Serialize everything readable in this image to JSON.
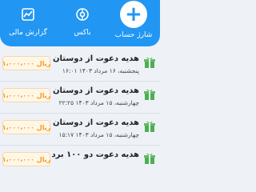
{
  "actions": {
    "report_label": "گزارش مالی",
    "box_label": "باکس",
    "charge_label": "شارژ حساب"
  },
  "colors": {
    "primary": "#2196f3",
    "amount_text": "#f29b1d",
    "gift_icon": "#4caf50"
  },
  "transactions": [
    {
      "title": "هدیه دعوت از دوستان",
      "date": "پنجشنبه، ۱۶ مرداد ۱۴۰۳ ۱۶:۰۱",
      "amount": "۱،۰۰۰،۰۰۰ ریال",
      "icon": "gift-icon"
    },
    {
      "title": "هدیه دعوت از دوستان",
      "date": "چهارشنبه، ۱۵ مرداد ۱۴۰۳ ۲۲:۲۵",
      "amount": "۱،۰۰۰،۰۰۰ ریال",
      "icon": "gift-icon"
    },
    {
      "title": "هدیه دعوت از دوستان",
      "date": "چهارشنبه، ۱۵ مرداد ۱۴۰۳ ۱۵:۱۷",
      "amount": "۱،۰۰۰،۰۰۰ ریال",
      "icon": "gift-icon"
    },
    {
      "title": "هدیه دعوت دو ۱۰۰ برد",
      "date": "",
      "amount": "۱،۰۰۰،۰۰۰ ریال",
      "icon": "gift-icon"
    }
  ]
}
